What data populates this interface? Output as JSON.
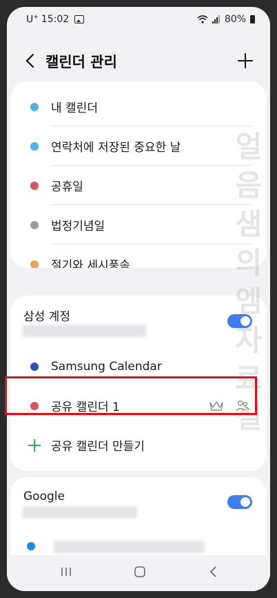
{
  "status": {
    "carrier": "U",
    "carrier_sup": "+",
    "time": "15:02",
    "battery": "80%"
  },
  "header": {
    "title": "캘린더 관리",
    "back_icon": "chevron-left-icon",
    "add_icon": "plus-icon"
  },
  "local_calendars": [
    {
      "label": "내 캘린더",
      "color": "#4ab6e0"
    },
    {
      "label": "연락처에 저장된 중요한 날",
      "color": "#4ab6e0"
    },
    {
      "label": "공휴일",
      "color": "#d9555f"
    },
    {
      "label": "법정기념일",
      "color": "#9a9a9a"
    },
    {
      "label": "절기와 세시풍속",
      "color": "#f0a35c"
    }
  ],
  "samsung_account": {
    "title": "삼성 계정",
    "toggle_on": true,
    "calendars": [
      {
        "label": "Samsung Calendar",
        "color": "#2b4fb3"
      },
      {
        "label": "공유 캘린더 1",
        "color": "#d9555f",
        "icons": [
          "crown-icon",
          "people-icon"
        ]
      }
    ],
    "create_label": "공유 캘린더 만들기"
  },
  "google_account": {
    "title": "Google",
    "toggle_on": true,
    "calendar_color": "#1a8fe0"
  },
  "watermark": "얼음샘의엠자료실",
  "colors": {
    "accent": "#3e7cf0",
    "highlight": "#e0101a",
    "add_green": "#2fae4f"
  }
}
